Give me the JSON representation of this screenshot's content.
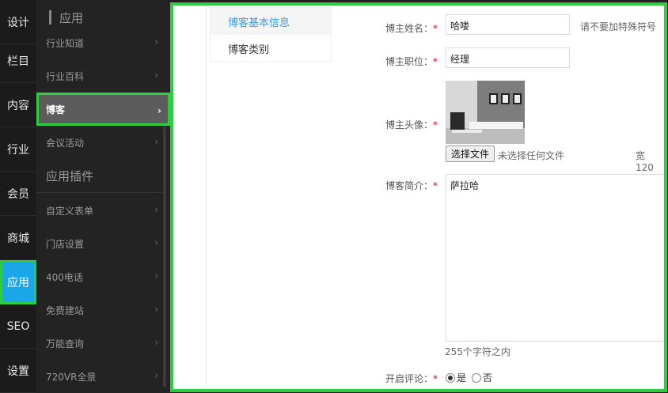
{
  "rail": {
    "items": [
      {
        "label": "设计"
      },
      {
        "label": "栏目"
      },
      {
        "label": "内容"
      },
      {
        "label": "行业"
      },
      {
        "label": "会员"
      },
      {
        "label": "商城"
      },
      {
        "label": "应用",
        "active": true
      },
      {
        "label": "SEO"
      },
      {
        "label": "设置"
      }
    ]
  },
  "sidebar": {
    "title": "应用",
    "items": [
      {
        "label": "行业知道"
      },
      {
        "label": "行业百科"
      },
      {
        "label": "博客",
        "active": true
      },
      {
        "label": "会议活动"
      }
    ],
    "group_title": "应用插件",
    "plugins": [
      {
        "label": "自定义表单"
      },
      {
        "label": "门店设置"
      },
      {
        "label": "400电话"
      },
      {
        "label": "免费建站"
      },
      {
        "label": "万能查询"
      },
      {
        "label": "720VR全景"
      }
    ]
  },
  "tabs": [
    {
      "label": "博客基本信息",
      "active": true
    },
    {
      "label": "博客类别"
    }
  ],
  "form": {
    "name_label": "博主姓名：",
    "name_value": "哈喽",
    "name_hint": "请不要加特殊符号",
    "title_label": "博主职位：",
    "title_value": "经理",
    "avatar_label": "博主头像：",
    "file_button": "选择文件",
    "file_status": "未选择任何文件",
    "width_hint": "宽 120",
    "intro_label": "博客简介：",
    "intro_value": "萨拉哈",
    "intro_hint": "255个字符之内",
    "comment_label": "开启评论：",
    "comment_yes": "是",
    "comment_no": "否",
    "comment_selected": "是",
    "required_mark": "*"
  },
  "colors": {
    "accent": "#1aa6e8",
    "highlight": "#2ecc40",
    "tab_active": "#3a9be0",
    "required": "#e2001a"
  }
}
